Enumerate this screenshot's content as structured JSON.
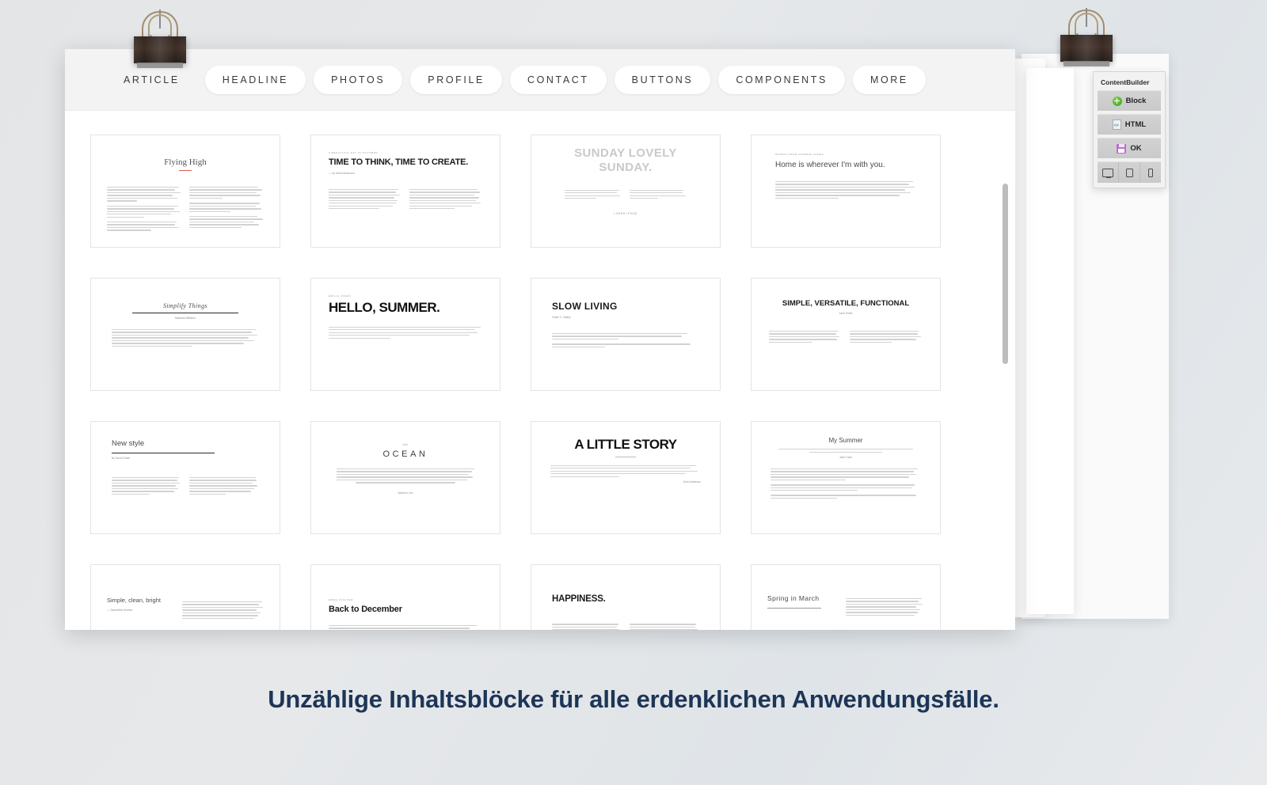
{
  "caption": "Unzählige Inhaltsblöcke für alle erdenklichen Anwendungsfälle.",
  "toolbar": {
    "tabs": [
      {
        "label": "ARTICLE",
        "active": true
      },
      {
        "label": "HEADLINE",
        "active": false
      },
      {
        "label": "PHOTOS",
        "active": false
      },
      {
        "label": "PROFILE",
        "active": false
      },
      {
        "label": "CONTACT",
        "active": false
      },
      {
        "label": "BUTTONS",
        "active": false
      },
      {
        "label": "COMPONENTS",
        "active": false
      },
      {
        "label": "MORE",
        "active": false
      }
    ]
  },
  "panel": {
    "title": "ContentBuilder",
    "buttons": [
      {
        "label": "Block",
        "icon": "add-block-icon"
      },
      {
        "label": "HTML",
        "icon": "html-code-icon"
      },
      {
        "label": "OK",
        "icon": "save-floppy-icon"
      }
    ],
    "devices": [
      {
        "name": "desktop-view-icon"
      },
      {
        "name": "tablet-view-icon"
      },
      {
        "name": "mobile-view-icon"
      }
    ]
  },
  "scrollbar": {
    "thumb_position_percent": 6,
    "thumb_size_percent": 40
  },
  "colors": {
    "caption": "#1d3557",
    "background": "#e5e7e9",
    "toolbar": "#f3f3f3",
    "accent_red": "#e05a4a",
    "block_green": "#3fa215",
    "save_purple": "#b96fd0"
  },
  "blocks": [
    {
      "id": 1,
      "layout": "serif-center-two-col",
      "title": "Flying High",
      "kicker": "",
      "byline": "",
      "rule": "red"
    },
    {
      "id": 2,
      "layout": "bold-left-two-col",
      "kicker": "A BEAUTIFUL DAY IN OCTOBER",
      "title": "TIME TO THINK, TIME TO CREATE.",
      "byline": "— by David Anderson"
    },
    {
      "id": 3,
      "layout": "ghost-center-two-col",
      "title": "SUNDAY LOVELY SUNDAY.",
      "kicker": "",
      "byline": "LOREM IPSUM"
    },
    {
      "id": 4,
      "layout": "light-left-single",
      "kicker": "WORDS FROM ANDREW JONES",
      "title": "Home is wherever I'm with you.",
      "byline": ""
    },
    {
      "id": 5,
      "layout": "serif-italic-center",
      "title": "Simplify Things",
      "byline": "Natasha Williams",
      "rule": "dark"
    },
    {
      "id": 6,
      "layout": "huge-left-single",
      "kicker": "EMILIA JONES",
      "title": "HELLO, SUMMER."
    },
    {
      "id": 7,
      "layout": "bold-left-single",
      "title": "SLOW LIVING",
      "byline": "Vivian C. Bailey"
    },
    {
      "id": 8,
      "layout": "bold-center-two-col",
      "title": "SIMPLE, VERSATILE, FUNCTIONAL",
      "byline": "Jane Smith"
    },
    {
      "id": 9,
      "layout": "light-left-ruled-two-col",
      "title": "New style",
      "byline": "By David Smith",
      "rule": "dark"
    },
    {
      "id": 10,
      "layout": "spaced-center-single",
      "kicker": "the",
      "title": "OCEAN",
      "byline": "Spencer Lee"
    },
    {
      "id": 11,
      "layout": "huge-center-single",
      "title": "A LITTLE STORY",
      "byline": "John Anderson",
      "rule": "grey"
    },
    {
      "id": 12,
      "layout": "light-center-quote",
      "title": "My Summer",
      "quote": "\"Lorem ipsum is simply dummy text of the printing and typesetting industry.\"",
      "byline": "Jane Clark"
    },
    {
      "id": 13,
      "layout": "light-left-side-col",
      "title": "Simple, clean, bright",
      "byline": "— Samantha Holmes"
    },
    {
      "id": 14,
      "layout": "bold-left-single-b",
      "kicker": "EMMA STALKER",
      "title": "Back to December"
    },
    {
      "id": 15,
      "layout": "bold-left-two-col-b",
      "title": "HAPPINESS."
    },
    {
      "id": 16,
      "layout": "light-left-side-col-b",
      "title": "Spring in March",
      "rule": "grey"
    }
  ]
}
